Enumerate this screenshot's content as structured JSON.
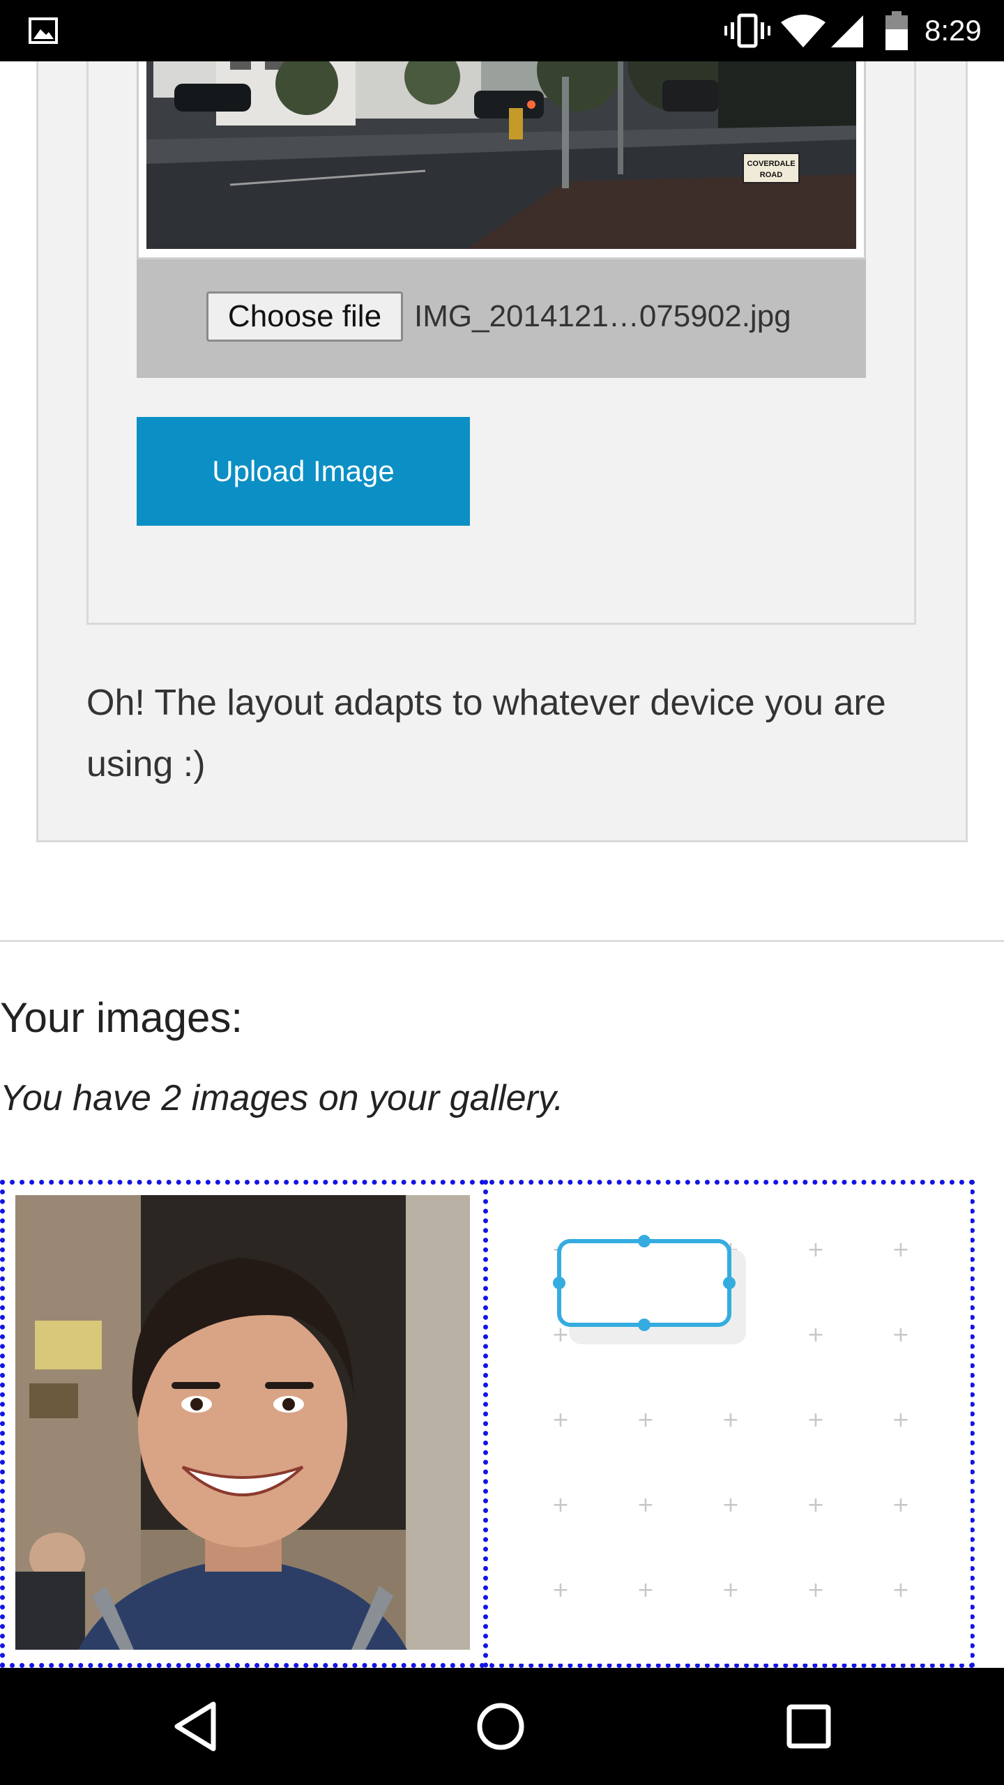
{
  "status_bar": {
    "time": "8:29",
    "icons": [
      "gallery-icon",
      "vibrate-icon",
      "wifi-icon",
      "signal-icon",
      "battery-icon"
    ]
  },
  "upload_form": {
    "preview_sign_text": "COVERDALE ROAD",
    "choose_file_label": "Choose file",
    "file_name": "IMG_2014121…075902.jpg",
    "upload_button_label": "Upload Image",
    "button_color": "#0b8fc4"
  },
  "adapt_note": "Oh! The layout adapts to whatever device you are using :)",
  "gallery": {
    "heading": "Your images:",
    "count_text": "You have 2 images on your gallery.",
    "border_color": "#1414e6",
    "images": [
      "portrait-photo",
      "diagram-icon"
    ]
  },
  "nav_bar": {
    "icons": [
      "back-icon",
      "home-icon",
      "recents-icon"
    ]
  }
}
